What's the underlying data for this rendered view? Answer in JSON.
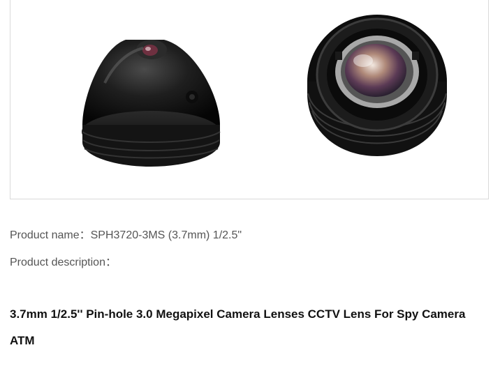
{
  "product": {
    "name_label": "Product name：",
    "name_value": "SPH3720-3MS (3.7mm) 1/2.5\"",
    "description_label": "Product description：",
    "title": "3.7mm 1/2.5'' Pin-hole 3.0 Megapixel Camera Lenses CCTV Lens For Spy Camera ATM"
  },
  "colors": {
    "text_muted": "#555555",
    "text_title": "#111111",
    "border": "#d9d9d9"
  }
}
